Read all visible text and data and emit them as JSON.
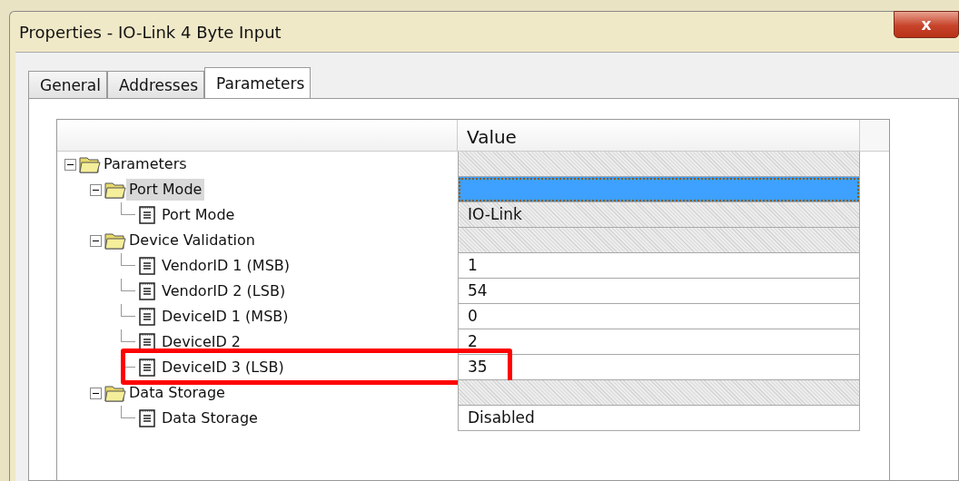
{
  "window": {
    "title": "Properties - IO-Link 4 Byte Input",
    "close_label": "x"
  },
  "tabs": [
    {
      "label": "General",
      "selected": false
    },
    {
      "label": "Addresses",
      "selected": false
    },
    {
      "label": "Parameters",
      "selected": true
    }
  ],
  "grid": {
    "columns": [
      "Value"
    ],
    "rows": [
      {
        "kind": "group",
        "name": "Parameters",
        "expanded": true,
        "selected": false,
        "children": [
          {
            "kind": "group",
            "name": "Port Mode",
            "expanded": true,
            "selected": true,
            "children": [
              {
                "kind": "item",
                "name": "Port Mode",
                "value": "IO-Link",
                "editable": false,
                "highlighted": false
              }
            ]
          },
          {
            "kind": "group",
            "name": "Device Validation",
            "expanded": true,
            "selected": false,
            "children": [
              {
                "kind": "item",
                "name": "VendorID 1 (MSB)",
                "value": "1",
                "editable": true,
                "highlighted": false
              },
              {
                "kind": "item",
                "name": "VendorID 2 (LSB)",
                "value": "54",
                "editable": true,
                "highlighted": false
              },
              {
                "kind": "item",
                "name": "DeviceID 1 (MSB)",
                "value": "0",
                "editable": true,
                "highlighted": false
              },
              {
                "kind": "item",
                "name": "DeviceID 2",
                "value": "2",
                "editable": true,
                "highlighted": false
              },
              {
                "kind": "item",
                "name": "DeviceID 3 (LSB)",
                "value": "35",
                "editable": true,
                "highlighted": true
              }
            ]
          },
          {
            "kind": "group",
            "name": "Data Storage",
            "expanded": true,
            "selected": false,
            "children": [
              {
                "kind": "item",
                "name": "Data Storage",
                "value": "Disabled",
                "editable": true,
                "highlighted": false
              }
            ]
          }
        ]
      }
    ]
  }
}
